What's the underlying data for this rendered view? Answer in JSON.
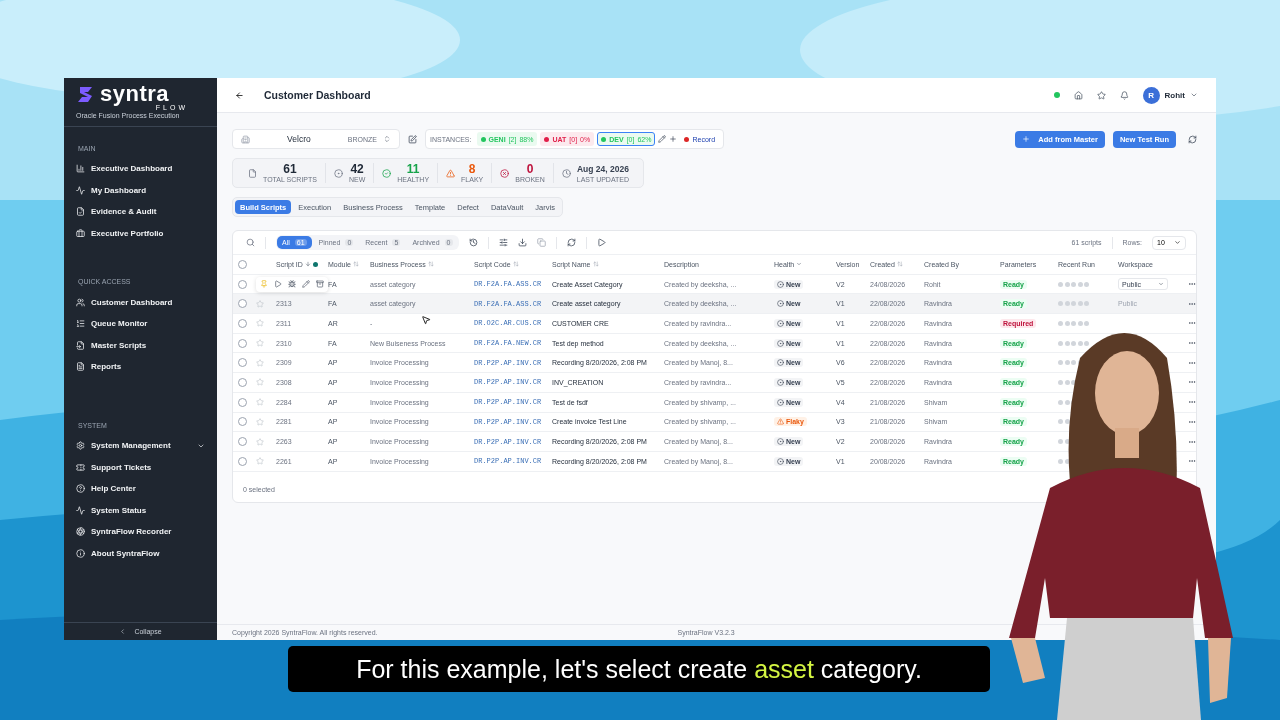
{
  "brand": {
    "name": "syntra",
    "sub": "FLOW",
    "tagline": "Oracle Fusion Process Execution"
  },
  "sidebar": {
    "sections": [
      {
        "title": "MAIN",
        "items": [
          {
            "label": "Executive Dashboard"
          },
          {
            "label": "My Dashboard"
          },
          {
            "label": "Evidence & Audit"
          },
          {
            "label": "Executive Portfolio"
          }
        ]
      },
      {
        "title": "QUICK ACCESS",
        "items": [
          {
            "label": "Customer Dashboard"
          },
          {
            "label": "Queue Monitor"
          },
          {
            "label": "Master Scripts"
          },
          {
            "label": "Reports"
          }
        ]
      },
      {
        "title": "SYSTEM",
        "items": [
          {
            "label": "System Management",
            "expandable": true
          },
          {
            "label": "Support Tickets"
          },
          {
            "label": "Help Center"
          },
          {
            "label": "System Status"
          },
          {
            "label": "SyntraFlow Recorder"
          },
          {
            "label": "About SyntraFlow"
          }
        ]
      }
    ],
    "collapse": "Collapse"
  },
  "header": {
    "title": "Customer Dashboard",
    "user_initial": "R",
    "user_name": "Rohit"
  },
  "customer": {
    "name": "Velcro",
    "tier": "BRONZE"
  },
  "instances": {
    "label": "INSTANCES:",
    "items": [
      {
        "name": "GENI",
        "count": "[2]",
        "pct": "88%",
        "color": "#22c55e",
        "selected": false
      },
      {
        "name": "UAT",
        "count": "[0]",
        "pct": "0%",
        "color": "#e11d48",
        "selected": false
      },
      {
        "name": "DEV",
        "count": "[0]",
        "pct": "62%",
        "color": "#22c55e",
        "selected": true
      }
    ],
    "record": "Record"
  },
  "actions": {
    "add": "Add from Master",
    "run": "New Test Run"
  },
  "stats": [
    {
      "value": "61",
      "label": "TOTAL SCRIPTS",
      "color": "#1f2937"
    },
    {
      "value": "42",
      "label": "NEW",
      "color": "#1f2937"
    },
    {
      "value": "11",
      "label": "HEALTHY",
      "color": "#16a34a"
    },
    {
      "value": "8",
      "label": "FLAKY",
      "color": "#ea580c"
    },
    {
      "value": "0",
      "label": "BROKEN",
      "color": "#be123c"
    },
    {
      "value": "Aug 24, 2026",
      "label": "LAST UPDATED",
      "color": "#374151"
    }
  ],
  "tabs": [
    {
      "label": "Build Scripts",
      "selected": true
    },
    {
      "label": "Execution",
      "selected": false
    },
    {
      "label": "Business Process",
      "selected": false
    },
    {
      "label": "Template",
      "selected": false
    },
    {
      "label": "Defect",
      "selected": false
    },
    {
      "label": "DataVault",
      "selected": false
    },
    {
      "label": "Jarvis",
      "selected": false
    }
  ],
  "filters": [
    {
      "label": "All",
      "count": "61",
      "selected": true
    },
    {
      "label": "Pinned",
      "count": "0",
      "selected": false
    },
    {
      "label": "Recent",
      "count": "5",
      "selected": false
    },
    {
      "label": "Archived",
      "count": "0",
      "selected": false
    }
  ],
  "table": {
    "summary": "61 scripts",
    "rows_label": "Rows:",
    "rows_value": "10",
    "columns": [
      "Script ID",
      "Module",
      "Business Process",
      "Script Code",
      "Script Name",
      "Description",
      "Health",
      "Version",
      "Created",
      "Created By",
      "Parameters",
      "Recent Run",
      "Workspace"
    ],
    "rows": [
      {
        "checked": false,
        "hover_actions": true,
        "highlighted": false,
        "module": "FA",
        "process": "asset category",
        "code": "DR.F2A.FA.ASS.CR",
        "name": "Create Asset Category",
        "description": "Created by deeksha, ...",
        "health": {
          "kind": "new",
          "label": "New"
        },
        "version": "V2",
        "created": "24/08/2026",
        "by": "Rohit",
        "params": {
          "kind": "ready",
          "label": "Ready"
        },
        "workspace": {
          "kind": "dropdown",
          "value": "Public"
        }
      },
      {
        "checked": false,
        "hover_actions": false,
        "highlighted": true,
        "id": "2313",
        "module": "FA",
        "process": "asset category",
        "code": "DR.F2A.FA.ASS.CR",
        "name": "Create asset category",
        "description": "Created by deeksha, ...",
        "health": {
          "kind": "new",
          "label": "New"
        },
        "version": "V1",
        "created": "22/08/2026",
        "by": "Ravindra",
        "params": {
          "kind": "ready",
          "label": "Ready"
        },
        "workspace": {
          "kind": "text",
          "value": "Public"
        }
      },
      {
        "checked": false,
        "hover_actions": false,
        "highlighted": false,
        "id": "2311",
        "module": "AR",
        "process": "-",
        "code": "DR.O2C.AR.CUS.CR",
        "name": "CUSTOMER CRE",
        "description": "Created by ravindra...",
        "health": {
          "kind": "new",
          "label": "New"
        },
        "version": "V1",
        "created": "22/08/2026",
        "by": "Ravindra",
        "params": {
          "kind": "required",
          "label": "Required"
        }
      },
      {
        "checked": false,
        "hover_actions": false,
        "highlighted": false,
        "id": "2310",
        "module": "FA",
        "process": "New Buiseness Process",
        "code": "DR.F2A.FA.NEW.CR",
        "name": "Test dep method",
        "description": "Created by deeksha, ...",
        "health": {
          "kind": "new",
          "label": "New"
        },
        "version": "V1",
        "created": "22/08/2026",
        "by": "Ravindra",
        "params": {
          "kind": "ready",
          "label": "Ready"
        }
      },
      {
        "checked": false,
        "hover_actions": false,
        "highlighted": false,
        "id": "2309",
        "module": "AP",
        "process": "Invoice Processing",
        "code": "DR.P2P.AP.INV.CR",
        "name": "Recording 8/20/2026, 2:08 PM",
        "description": "Created by Manoj, 8...",
        "health": {
          "kind": "new",
          "label": "New"
        },
        "version": "V6",
        "created": "22/08/2026",
        "by": "Ravindra",
        "params": {
          "kind": "ready",
          "label": "Ready"
        }
      },
      {
        "checked": false,
        "hover_actions": false,
        "highlighted": false,
        "id": "2308",
        "module": "AP",
        "process": "Invoice Processing",
        "code": "DR.P2P.AP.INV.CR",
        "name": "INV_CREATION",
        "description": "Created by ravindra...",
        "health": {
          "kind": "new",
          "label": "New"
        },
        "version": "V5",
        "created": "22/08/2026",
        "by": "Ravindra",
        "params": {
          "kind": "ready",
          "label": "Ready"
        }
      },
      {
        "checked": false,
        "hover_actions": false,
        "highlighted": false,
        "id": "2284",
        "module": "AP",
        "process": "Invoice Processing",
        "code": "DR.P2P.AP.INV.CR",
        "name": "Test de fsdf",
        "description": "Created by shivamp, ...",
        "health": {
          "kind": "new",
          "label": "New"
        },
        "version": "V4",
        "created": "21/08/2026",
        "by": "Shivam",
        "params": {
          "kind": "ready",
          "label": "Ready"
        }
      },
      {
        "checked": false,
        "hover_actions": false,
        "highlighted": false,
        "id": "2281",
        "module": "AP",
        "process": "Invoice Processing",
        "code": "DR.P2P.AP.INV.CR",
        "name": "Create invoice Test Line",
        "description": "Created by shivamp, ...",
        "health": {
          "kind": "flaky",
          "label": "Flaky"
        },
        "version": "V3",
        "created": "21/08/2026",
        "by": "Shivam",
        "params": {
          "kind": "ready",
          "label": "Ready"
        }
      },
      {
        "checked": false,
        "hover_actions": false,
        "highlighted": false,
        "id": "2263",
        "module": "AP",
        "process": "Invoice Processing",
        "code": "DR.P2P.AP.INV.CR",
        "name": "Recording 8/20/2026, 2:08 PM",
        "description": "Created by Manoj, 8...",
        "health": {
          "kind": "new",
          "label": "New"
        },
        "version": "V2",
        "created": "20/08/2026",
        "by": "Ravindra",
        "params": {
          "kind": "ready",
          "label": "Ready"
        }
      },
      {
        "checked": false,
        "hover_actions": false,
        "highlighted": false,
        "id": "2261",
        "module": "AP",
        "process": "Invoice Processing",
        "code": "DR.P2P.AP.INV.CR",
        "name": "Recording 8/20/2026, 2:08 PM",
        "description": "Created by Manoj, 8...",
        "health": {
          "kind": "new",
          "label": "New"
        },
        "version": "V1",
        "created": "20/08/2026",
        "by": "Ravindra",
        "params": {
          "kind": "ready",
          "label": "Ready"
        }
      }
    ],
    "selected_count": "0 selected",
    "all_checked": false
  },
  "footer": {
    "copyright": "Copyright 2026 SyntraFlow. All rights reserved.",
    "version": "SyntraFlow V3.2.3"
  },
  "caption": [
    {
      "text": "For this example, let's select create ",
      "highlight": false
    },
    {
      "text": "asset",
      "highlight": true
    },
    {
      "text": " category.",
      "highlight": false
    }
  ]
}
